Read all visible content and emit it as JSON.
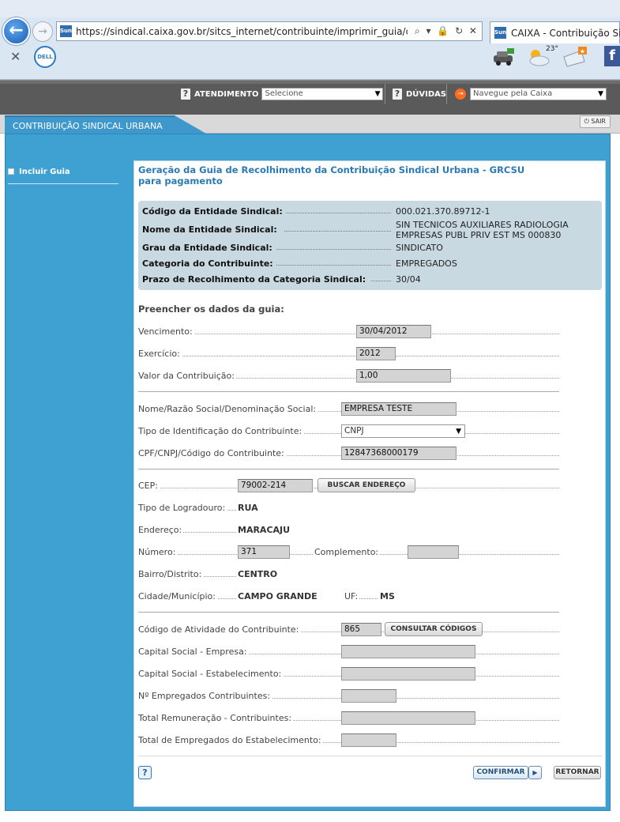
{
  "browser": {
    "url": "https://sindical.caixa.gov.br/sitcs_internet/contribuinte/imprimir_guia/consulta",
    "url_controls": "⌕ ▾ 🔒 ↻ ✕",
    "tab_title": "CAIXA - Contribuição Sindi",
    "site_icon_text": "Sun",
    "close_toolbar": "✕",
    "dell_text": "DELL",
    "weather_temp": "23°"
  },
  "header": {
    "atendimento_label": "ATENDIMENTO",
    "atendimento_select": "Selecione",
    "duvidas_label": "DÚVIDAS",
    "navegue_select": "Navegue pela Caixa",
    "question_icon": "?",
    "arrow_glyph": "→",
    "select_arrow": "▼"
  },
  "nav": {
    "main_tab": "CONTRIBUIÇÃO SINDICAL URBANA",
    "sair_label": "SAIR"
  },
  "sidebar": {
    "items": [
      {
        "label": "Incluir Guia"
      }
    ]
  },
  "page": {
    "title": "Geração da Guia de Recolhimento da Contribuição Sindical Urbana - GRCSU para pagamento",
    "section_title": "Preencher os dados da guia:"
  },
  "entidade": {
    "rows": [
      {
        "label": "Código da Entidade Sindical:",
        "value": "000.021.370.89712-1"
      },
      {
        "label": "Nome da Entidade Sindical:",
        "value": "SIN TECNICOS AUXILIARES RADIOLOGIA EMPRESAS PUBL PRIV EST MS 000830"
      },
      {
        "label": "Grau da Entidade Sindical:",
        "value": "SINDICATO"
      },
      {
        "label": "Categoria do Contribuinte:",
        "value": "EMPREGADOS"
      },
      {
        "label": "Prazo de Recolhimento da Categoria Sindical:",
        "value": "30/04"
      }
    ]
  },
  "form": {
    "vencimento": {
      "label": "Vencimento:",
      "value": "30/04/2012"
    },
    "exercicio": {
      "label": "Exercício:",
      "value": "2012"
    },
    "valor": {
      "label": "Valor da Contribuição:",
      "value": "1,00"
    },
    "razao_social": {
      "label": "Nome/Razão Social/Denominação Social:",
      "value": "EMPRESA TESTE"
    },
    "tipo_id": {
      "label": "Tipo de Identificação do Contribuinte:",
      "value": "CNPJ"
    },
    "cpf_cnpj": {
      "label": "CPF/CNPJ/Código do Contribuinte:",
      "value": "12847368000179"
    },
    "cep": {
      "label": "CEP:",
      "value": "79002-214",
      "button": "BUSCAR ENDEREÇO"
    },
    "tipo_logradouro": {
      "label": "Tipo de Logradouro:",
      "value": "RUA"
    },
    "endereco": {
      "label": "Endereço:",
      "value": "MARACAJU"
    },
    "numero": {
      "label": "Número:",
      "value": "371"
    },
    "complemento": {
      "label": "Complemento:",
      "value": ""
    },
    "bairro": {
      "label": "Bairro/Distrito:",
      "value": "CENTRO"
    },
    "cidade": {
      "label": "Cidade/Município:",
      "value": "CAMPO GRANDE"
    },
    "uf": {
      "label": "UF:",
      "value": "MS"
    },
    "atividade": {
      "label": "Código de Atividade do Contribuinte:",
      "value": "865",
      "button": "CONSULTAR CÓDIGOS"
    },
    "capital_empresa": {
      "label": "Capital Social - Empresa:",
      "value": ""
    },
    "capital_estab": {
      "label": "Capital Social - Estabelecimento:",
      "value": ""
    },
    "num_empregados": {
      "label": "Nº Empregados Contribuintes:",
      "value": ""
    },
    "total_remuneracao": {
      "label": "Total Remuneração - Contribuintes:",
      "value": ""
    },
    "total_empregados": {
      "label": "Total de Empregados do Estabelecimento:",
      "value": ""
    }
  },
  "actions": {
    "help": "?",
    "confirm": "CONFIRMAR",
    "confirm_arrow": "▶",
    "return": "RETORNAR"
  }
}
